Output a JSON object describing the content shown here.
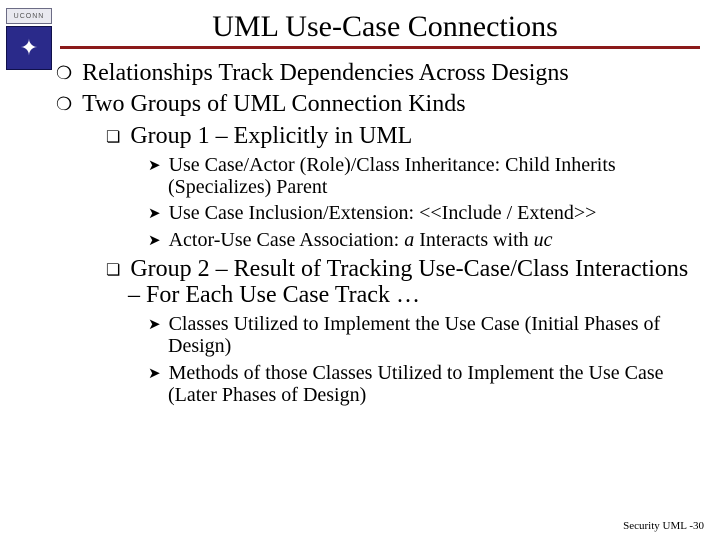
{
  "logo": {
    "top": "UCONN",
    "glyph": "✦"
  },
  "title": "UML Use-Case Connections",
  "bullets": {
    "l1a": "Relationships Track Dependencies Across Designs",
    "l1b": "Two Groups of UML Connection Kinds",
    "l2a": "Group 1 – Explicitly in UML",
    "l3a": "Use Case/Actor (Role)/Class Inheritance: Child Inherits (Specializes) Parent",
    "l3b": "Use Case Inclusion/Extension: <<Include / Extend>>",
    "l3c_pre": "Actor-Use Case Association: ",
    "l3c_a": "a",
    "l3c_mid": " Interacts with ",
    "l3c_uc": "uc",
    "l2b": "Group 2 – Result of Tracking Use-Case/Class Interactions – For Each Use Case Track …",
    "l3d": "Classes Utilized to Implement the Use Case (Initial Phases of Design)",
    "l3e": "Methods of those Classes Utilized to Implement the Use Case (Later Phases of Design)"
  },
  "footer": "Security UML -30"
}
